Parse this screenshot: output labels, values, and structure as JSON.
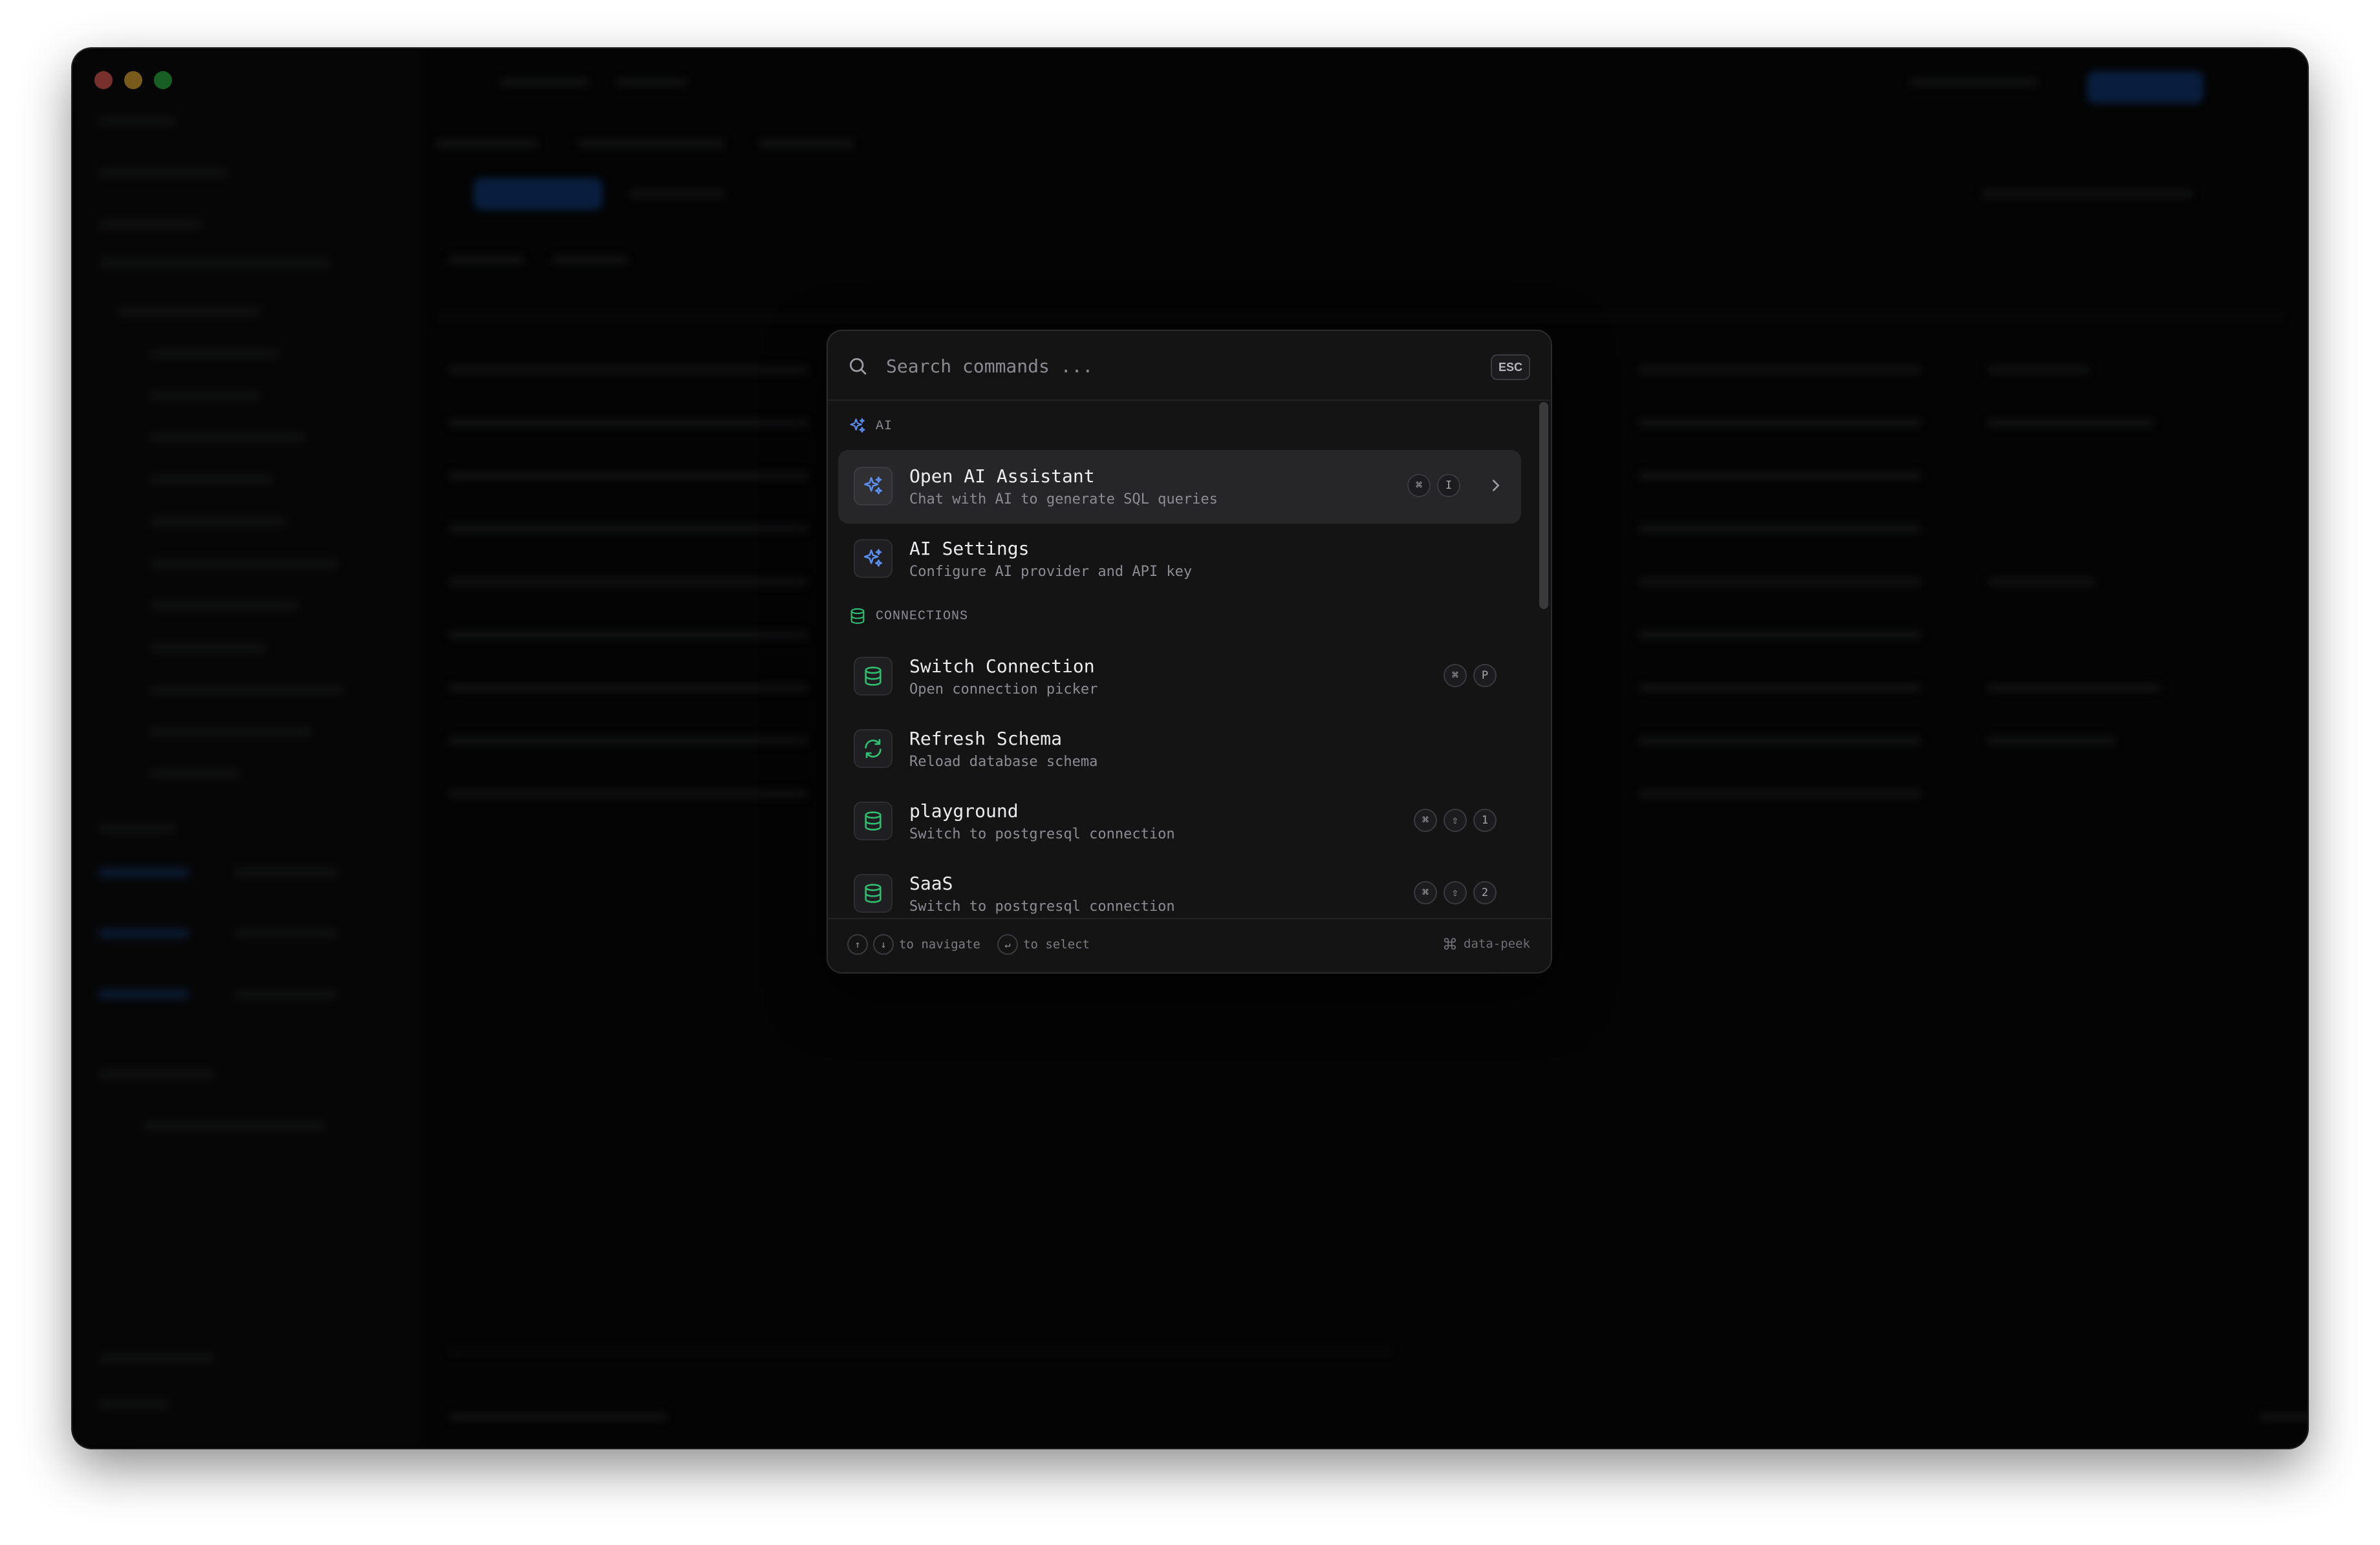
{
  "search": {
    "placeholder": "Search commands ...",
    "esc_label": "ESC"
  },
  "groups": {
    "ai": {
      "label": "AI"
    },
    "connections": {
      "label": "CONNECTIONS"
    }
  },
  "items": [
    {
      "title": "Open AI Assistant",
      "description": "Chat with AI to generate SQL queries",
      "keys": [
        "⌘",
        "I"
      ],
      "icon": "sparkles-icon"
    },
    {
      "title": "AI Settings",
      "description": "Configure AI provider and API key",
      "keys": [],
      "icon": "sparkles-icon"
    },
    {
      "title": "Switch Connection",
      "description": "Open connection picker",
      "keys": [
        "⌘",
        "P"
      ],
      "icon": "database-icon"
    },
    {
      "title": "Refresh Schema",
      "description": "Reload database schema",
      "keys": [],
      "icon": "refresh-icon"
    },
    {
      "title": "playground",
      "description": "Switch to postgresql connection",
      "keys": [
        "⌘",
        "⇧",
        "1"
      ],
      "icon": "database-icon"
    },
    {
      "title": "SaaS",
      "description": "Switch to postgresql connection",
      "keys": [
        "⌘",
        "⇧",
        "2"
      ],
      "icon": "database-icon"
    }
  ],
  "footer": {
    "up_key": "↑",
    "down_key": "↓",
    "navigate_label": "to navigate",
    "enter_key": "↵",
    "select_label": "to select",
    "brand_label": "data-peek"
  },
  "colors": {
    "ai_accent": "#5b8def",
    "connection_accent": "#2fbf71",
    "palette_bg": "#141415"
  }
}
